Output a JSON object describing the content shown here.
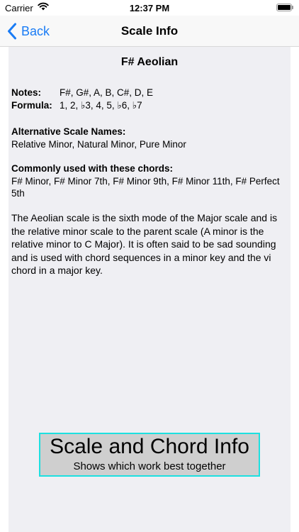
{
  "status_bar": {
    "carrier": "Carrier",
    "time": "12:37 PM",
    "icons": [
      "wifi-icon",
      "battery-icon"
    ]
  },
  "nav": {
    "back_label": "Back",
    "title": "Scale Info",
    "accent_color": "#1a7cf5"
  },
  "scale": {
    "name": "F# Aeolian",
    "notes_label": "Notes:",
    "notes_value": "F#, G#, A, B, C#, D, E",
    "formula_label": "Formula:",
    "formula_value": "1, 2, ♭3, 4, 5, ♭6, ♭7",
    "alt_names_heading": "Alternative Scale Names:",
    "alt_names_value": "Relative Minor, Natural Minor, Pure Minor",
    "chords_heading": "Commonly used with these chords:",
    "chords_value": "F# Minor, F# Minor 7th, F# Minor 9th, F# Minor 11th, F# Perfect 5th",
    "description": "The Aeolian scale is the sixth mode of the Major scale and is the relative minor scale to the parent scale (A minor is the relative minor to C Major). It is often said to be sad sounding and is used with chord sequences in a minor key and the vi chord in a major key."
  },
  "cta": {
    "title": "Scale and Chord Info",
    "subtitle": "Shows which work best together",
    "border_color": "#1de0e0"
  }
}
